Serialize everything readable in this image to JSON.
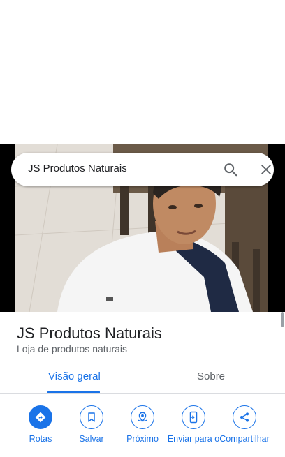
{
  "search": {
    "value": "JS Produtos Naturais"
  },
  "place": {
    "name": "JS Produtos Naturais",
    "category": "Loja de produtos naturais"
  },
  "tabs": [
    {
      "label": "Visão geral",
      "active": true
    },
    {
      "label": "Sobre",
      "active": false
    }
  ],
  "actions": [
    {
      "label": "Rotas",
      "icon": "directions-icon"
    },
    {
      "label": "Salvar",
      "icon": "bookmark-icon"
    },
    {
      "label": "Próximo",
      "icon": "nearby-icon"
    },
    {
      "label": "Enviar para o",
      "icon": "send-to-phone-icon"
    },
    {
      "label": "Compartilhar",
      "icon": "share-icon"
    }
  ],
  "colors": {
    "accent": "#1a73e8",
    "text_primary": "#202124",
    "text_secondary": "#5f6368"
  }
}
